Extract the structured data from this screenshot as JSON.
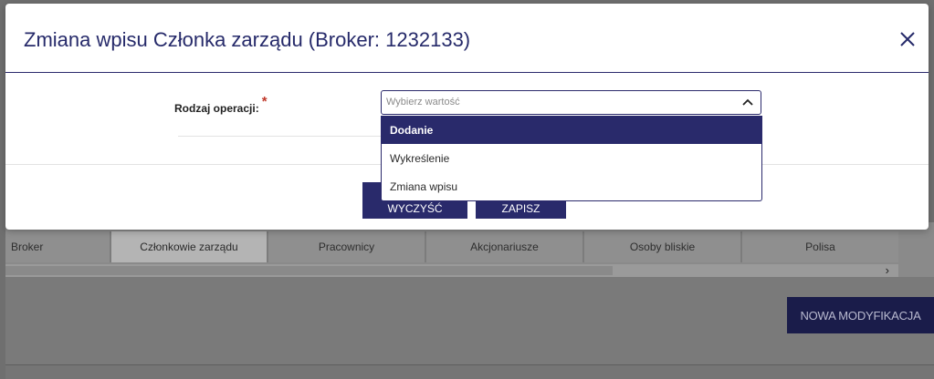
{
  "background": {
    "tabs": [
      {
        "label": "Broker"
      },
      {
        "label": "Członkowie zarządu"
      },
      {
        "label": "Pracownicy"
      },
      {
        "label": "Akcjonariusze"
      },
      {
        "label": "Osoby bliskie"
      },
      {
        "label": "Polisa"
      }
    ],
    "active_tab": "Członkowie zarządu",
    "scroll_arrow": "›",
    "new_modification_label": "NOWA MODYFIKACJA"
  },
  "modal": {
    "title": "Zmiana wpisu Członka zarządu (Broker: 1232133)",
    "close_icon": "close-icon",
    "field": {
      "label": "Rodzaj operacji:",
      "required_mark": "*",
      "placeholder": "Wybierz wartość"
    },
    "dropdown": {
      "options": [
        "Dodanie",
        "Wykreślenie",
        "Zmiana wpisu"
      ],
      "highlighted": "Dodanie"
    },
    "footer": {
      "clear_label": "WYCZYŚĆ",
      "save_label": "ZAPISZ"
    }
  },
  "colors": {
    "primary": "#292a6b",
    "required": "#c0392b",
    "overlay": "#6f6f6f"
  }
}
